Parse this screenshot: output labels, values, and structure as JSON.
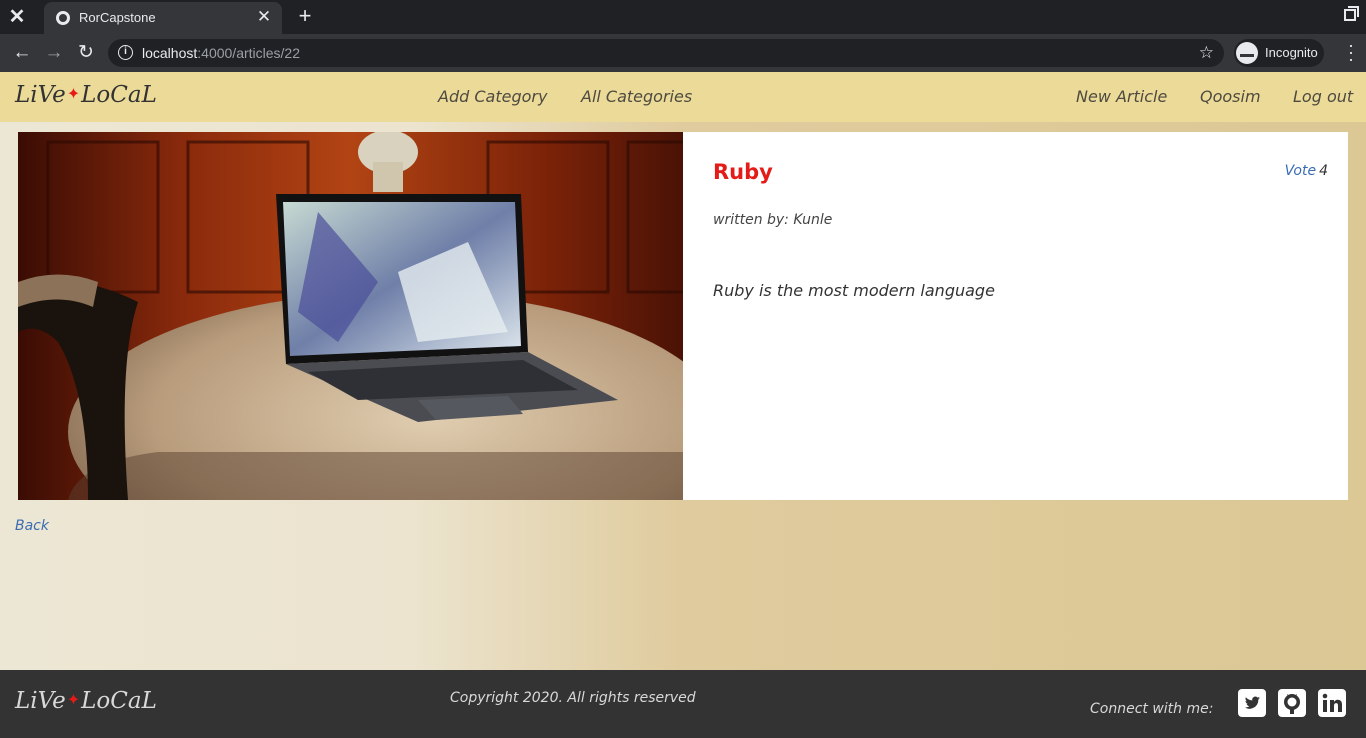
{
  "browser": {
    "tab_title": "RorCapstone",
    "url_host": "localhost",
    "url_rest": ":4000/articles/22",
    "profile_label": "Incognito"
  },
  "site": {
    "logo_left": "LiVe",
    "logo_right": "LoCaL",
    "logo_star": "✦"
  },
  "nav": {
    "left": [
      "Add Category",
      "All Categories"
    ],
    "right": [
      "New Article",
      "Qoosim",
      "Log out"
    ]
  },
  "article": {
    "title": "Ruby",
    "vote_label": "Vote",
    "vote_count": "4",
    "author": "written by: Kunle",
    "body": "Ruby is the most modern language"
  },
  "back_label": "Back",
  "footer": {
    "copyright": "Copyright 2020. All rights reserved",
    "connect": "Connect with me:",
    "social_icons": [
      "twitter-icon",
      "github-icon",
      "linkedin-icon"
    ]
  },
  "colors": {
    "nav_bg": "#ecdb98",
    "accent_red": "#e41b17",
    "link_blue": "#3b6db3",
    "footer_bg": "#333333"
  }
}
